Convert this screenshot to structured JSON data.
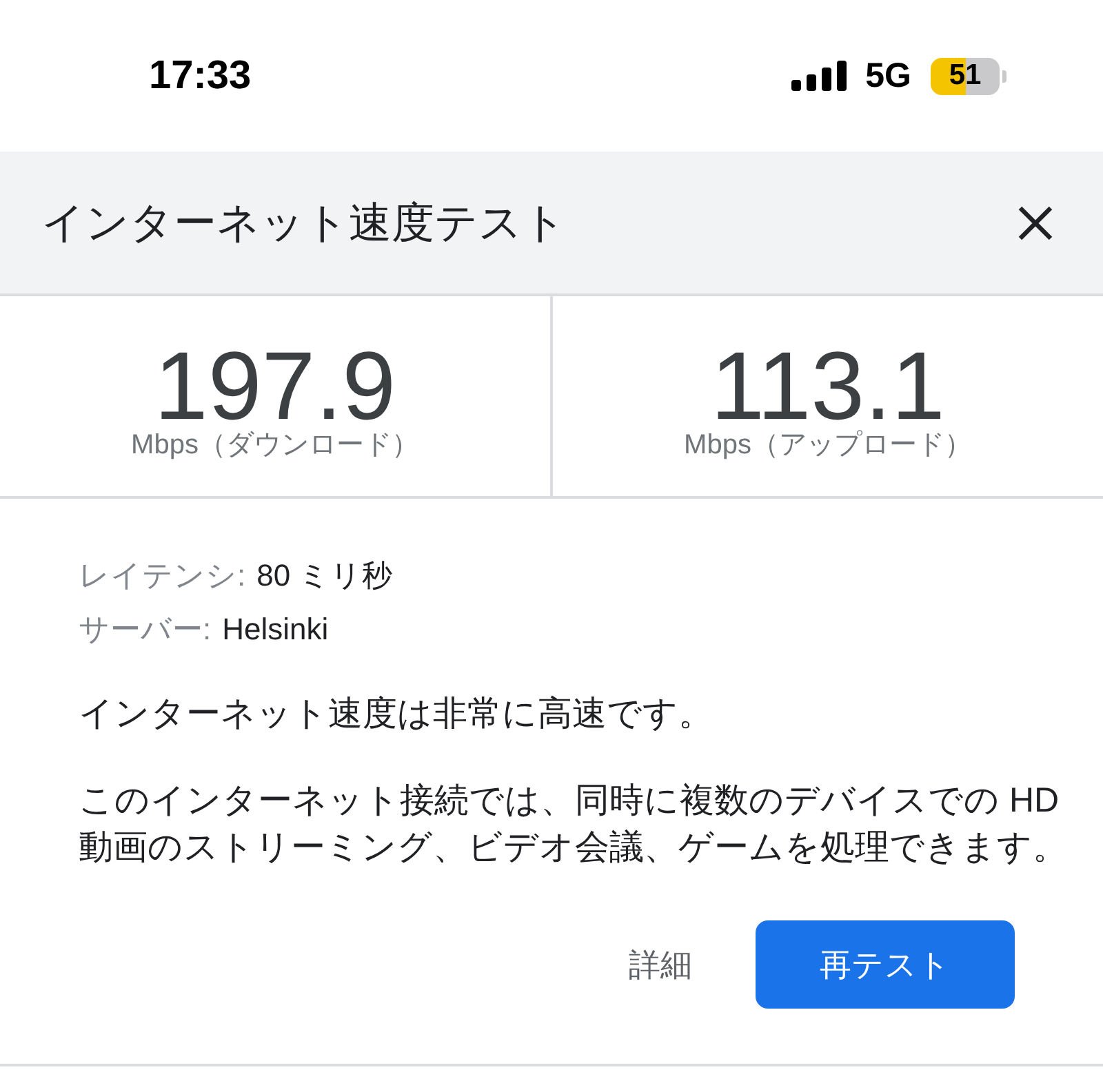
{
  "status_bar": {
    "time": "17:33",
    "network": "5G",
    "battery": {
      "percent": "51",
      "low_power_mode": true
    }
  },
  "dialog": {
    "title": "インターネット速度テスト"
  },
  "results": [
    {
      "value": "197.9",
      "unit": "Mbps（ダウンロード）"
    },
    {
      "value": "113.1",
      "unit": "Mbps（アップロード）"
    }
  ],
  "details": [
    {
      "label": "レイテンシ:",
      "value": "80 ミリ秒"
    },
    {
      "label": "サーバー:",
      "value": "Helsinki"
    }
  ],
  "summary": "インターネット速度は非常に高速です。",
  "description": "このインターネット接続では、同時に複数のデバイスでの HD 動画のストリーミング、ビデオ会議、ゲームを処理できます。",
  "actions": [
    {
      "label": "詳細",
      "kind": "text"
    },
    {
      "label": "再テスト",
      "kind": "primary"
    }
  ]
}
